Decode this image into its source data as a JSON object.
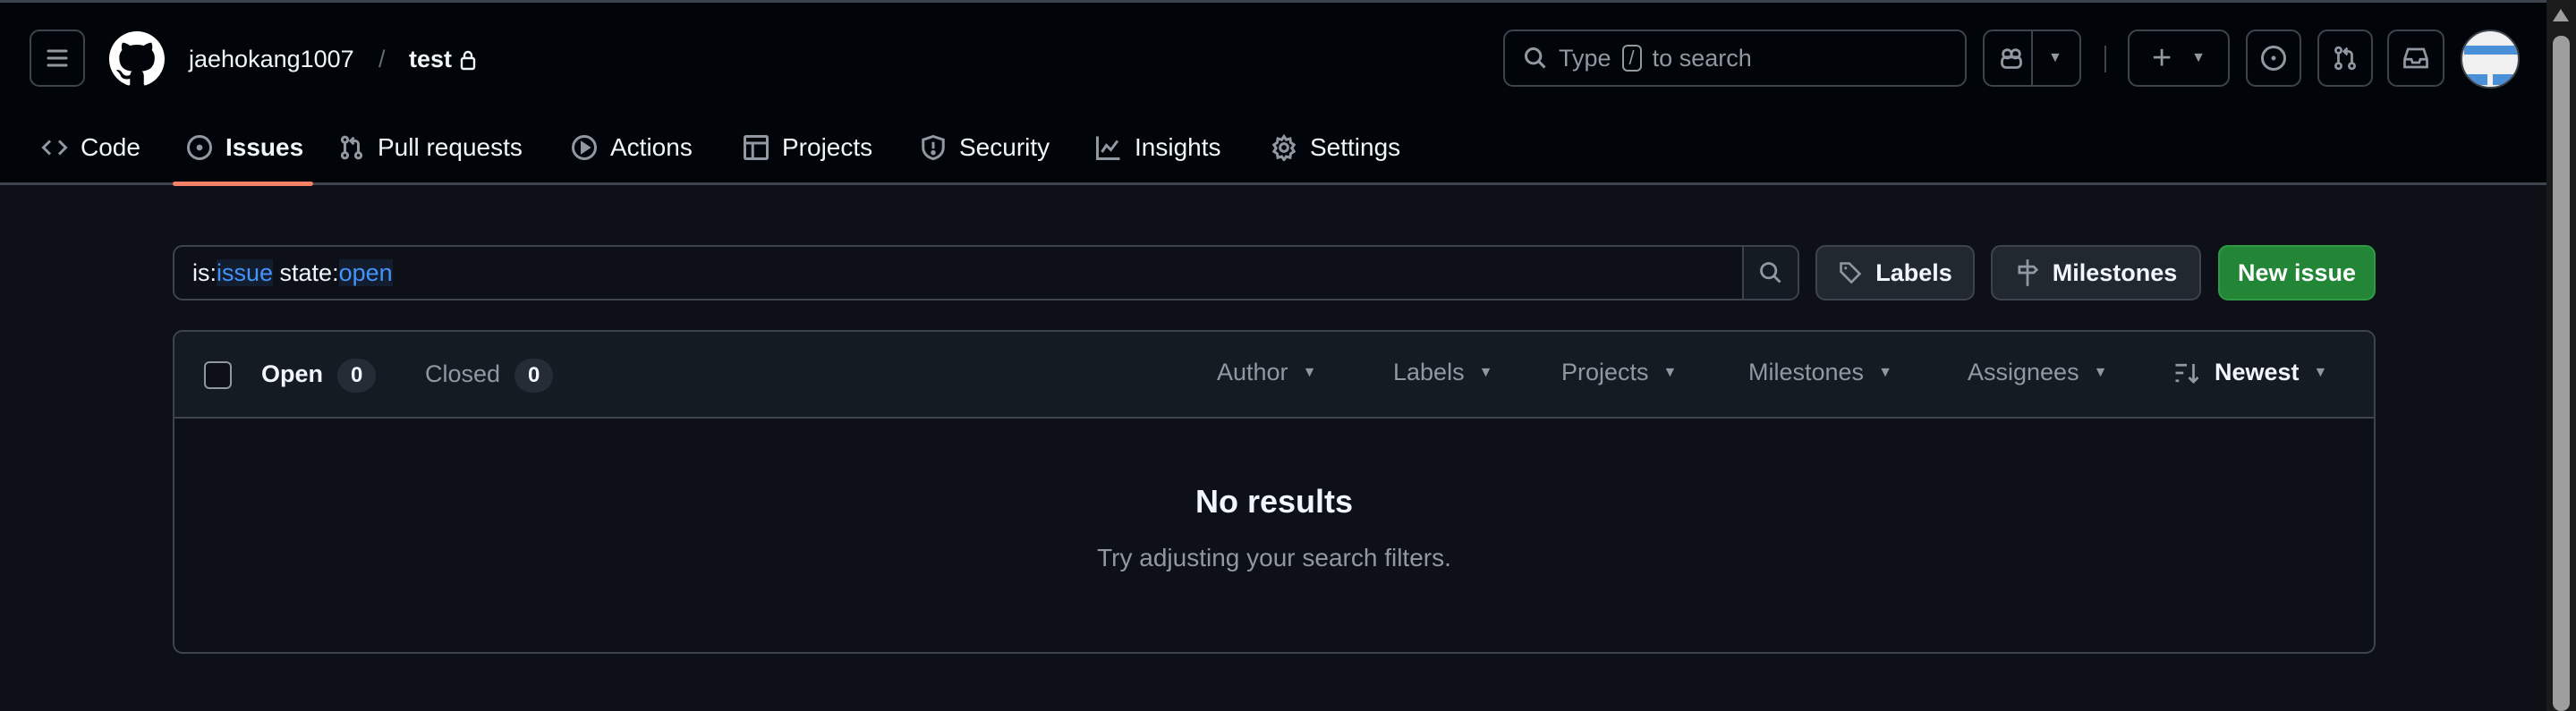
{
  "header": {
    "owner": "jaehokang1007",
    "separator": "/",
    "repo": "test",
    "search_placeholder_pre": "Type",
    "search_key": "/",
    "search_placeholder_post": "to search"
  },
  "tabs": [
    {
      "label": "Code",
      "icon": "code-icon"
    },
    {
      "label": "Issues",
      "icon": "issue-opened-icon",
      "active": true
    },
    {
      "label": "Pull requests",
      "icon": "git-pull-request-icon"
    },
    {
      "label": "Actions",
      "icon": "play-icon"
    },
    {
      "label": "Projects",
      "icon": "table-icon"
    },
    {
      "label": "Security",
      "icon": "shield-icon"
    },
    {
      "label": "Insights",
      "icon": "graph-icon"
    },
    {
      "label": "Settings",
      "icon": "gear-icon"
    }
  ],
  "filter": {
    "prefix1": "is:",
    "value1": "issue",
    "prefix2": " state:",
    "value2": "open"
  },
  "actions": {
    "labels": "Labels",
    "milestones": "Milestones",
    "new_issue": "New issue"
  },
  "list": {
    "open_label": "Open",
    "open_count": "0",
    "closed_label": "Closed",
    "closed_count": "0",
    "filters": [
      "Author",
      "Labels",
      "Projects",
      "Milestones",
      "Assignees"
    ],
    "sort": "Newest"
  },
  "empty": {
    "title": "No results",
    "subtitle": "Try adjusting your search filters."
  },
  "colors": {
    "accent": "#f78166",
    "primary": "#238636",
    "link": "#4493f8"
  }
}
